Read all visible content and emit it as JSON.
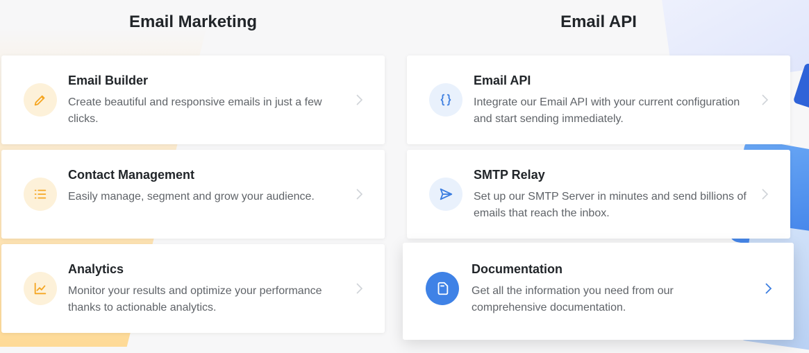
{
  "columns": {
    "left_title": "Email Marketing",
    "right_title": "Email API"
  },
  "cards": [
    {
      "title": "Email Builder",
      "description": "Create beautiful and responsive emails in just a few clicks.",
      "icon": "pencil-icon"
    },
    {
      "title": "Contact Management",
      "description": "Easily manage, segment and grow your audience.",
      "icon": "list-icon"
    },
    {
      "title": "Analytics",
      "description": "Monitor your results and optimize your performance thanks to actionable analytics.",
      "icon": "chart-icon"
    },
    {
      "title": "Email API",
      "description": "Integrate our Email API with your current configuration and start sending immediately.",
      "icon": "braces-icon"
    },
    {
      "title": "SMTP Relay",
      "description": "Set up our SMTP Server in minutes and send billions of emails that reach the inbox.",
      "icon": "send-icon"
    },
    {
      "title": "Documentation",
      "description": "Get all the information you need from our comprehensive documentation.",
      "icon": "document-icon"
    }
  ],
  "colors": {
    "orange_accent": "#f5a623",
    "blue_accent": "#3b7de0",
    "text_dark": "#212529",
    "text_muted": "#5f6368"
  }
}
